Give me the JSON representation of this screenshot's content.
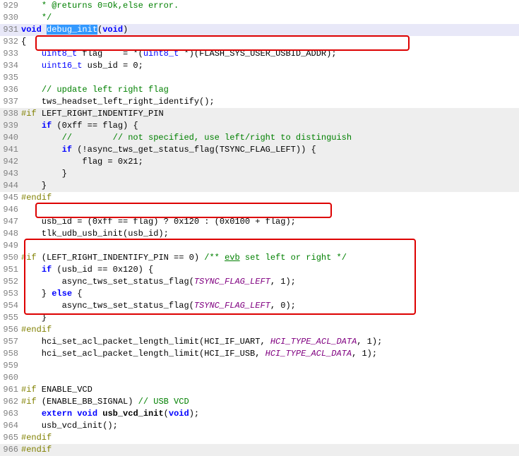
{
  "lines": [
    {
      "num": "929",
      "html": "    <span class='comment'>* @returns 0=Ok,else error.</span>"
    },
    {
      "num": "930",
      "html": "    <span class='comment'>*/</span>"
    },
    {
      "num": "931",
      "html": "<span class='keyword'>void</span> <span class='sel'>debug_init</span>(<span class='keyword'>void</span>)",
      "cursor": true
    },
    {
      "num": "932",
      "html": "{"
    },
    {
      "num": "933",
      "html": "    <span class='type'>uint8_t</span> flag    = *(<span class='type'>uint8_t</span> *)(FLASH_SYS_USER_USBID_ADDR);"
    },
    {
      "num": "934",
      "html": "    <span class='type'>uint16_t</span> usb_id = 0;"
    },
    {
      "num": "935",
      "html": ""
    },
    {
      "num": "936",
      "html": "    <span class='comment'>// update left right flag</span>"
    },
    {
      "num": "937",
      "html": "    tws_headset_left_right_identify();"
    },
    {
      "num": "938",
      "html": "<span class='preproc'>#if</span> LEFT_RIGHT_INDENTIFY_PIN",
      "inactive": true
    },
    {
      "num": "939",
      "html": "    <span class='keyword'>if</span> (0xff == flag) {",
      "inactive": true
    },
    {
      "num": "940",
      "html": "        <span class='comment'>//        // not specified, use left/right to distinguish</span>",
      "inactive": true
    },
    {
      "num": "941",
      "html": "        <span class='keyword'>if</span> (!async_tws_get_status_flag(TSYNC_FLAG_LEFT)) {",
      "inactive": true
    },
    {
      "num": "942",
      "html": "            flag = 0x21;",
      "inactive": true
    },
    {
      "num": "943",
      "html": "        }",
      "inactive": true
    },
    {
      "num": "944",
      "html": "    }",
      "inactive": true
    },
    {
      "num": "945",
      "html": "<span class='preproc'>#endif</span>"
    },
    {
      "num": "946",
      "html": ""
    },
    {
      "num": "947",
      "html": "    usb_id = (0xff == flag) ? 0x120 : (0x0100 + flag);"
    },
    {
      "num": "948",
      "html": "    tlk_udb_usb_init(usb_id);"
    },
    {
      "num": "949",
      "html": ""
    },
    {
      "num": "950",
      "html": "<span class='preproc'>#if</span> (LEFT_RIGHT_INDENTIFY_PIN == 0) <span class='comment'>/** <u>evb</u> set left or right */</span>"
    },
    {
      "num": "951",
      "html": "    <span class='keyword'>if</span> (usb_id == 0x120) {"
    },
    {
      "num": "952",
      "html": "        async_tws_set_status_flag(<span class='macro'>TSYNC_FLAG_LEFT</span>, 1);"
    },
    {
      "num": "953",
      "html": "    } <span class='keyword'>else</span> {"
    },
    {
      "num": "954",
      "html": "        async_tws_set_status_flag(<span class='macro'>TSYNC_FLAG_LEFT</span>, 0);"
    },
    {
      "num": "955",
      "html": "    }"
    },
    {
      "num": "956",
      "html": "<span class='preproc'>#endif</span>"
    },
    {
      "num": "957",
      "html": "    hci_set_acl_packet_length_limit(HCI_IF_UART, <span class='macro'>HCI_TYPE_ACL_DATA</span>, 1);"
    },
    {
      "num": "958",
      "html": "    hci_set_acl_packet_length_limit(HCI_IF_USB, <span class='macro'>HCI_TYPE_ACL_DATA</span>, 1);"
    },
    {
      "num": "959",
      "html": ""
    },
    {
      "num": "960",
      "html": ""
    },
    {
      "num": "961",
      "html": "<span class='preproc'>#if</span> ENABLE_VCD"
    },
    {
      "num": "962",
      "html": "<span class='preproc'>#if</span> (ENABLE_BB_SIGNAL) <span class='comment'>// USB VCD</span>"
    },
    {
      "num": "963",
      "html": "    <span class='keyword'>extern</span> <span class='keyword'>void</span> <span class='func'>usb_vcd_init</span>(<span class='keyword'>void</span>);"
    },
    {
      "num": "964",
      "html": "    usb_vcd_init();"
    },
    {
      "num": "965",
      "html": "<span class='preproc'>#endif</span>"
    },
    {
      "num": "966",
      "html": "<span class='preproc'>#endif</span>",
      "inactive": true
    }
  ]
}
